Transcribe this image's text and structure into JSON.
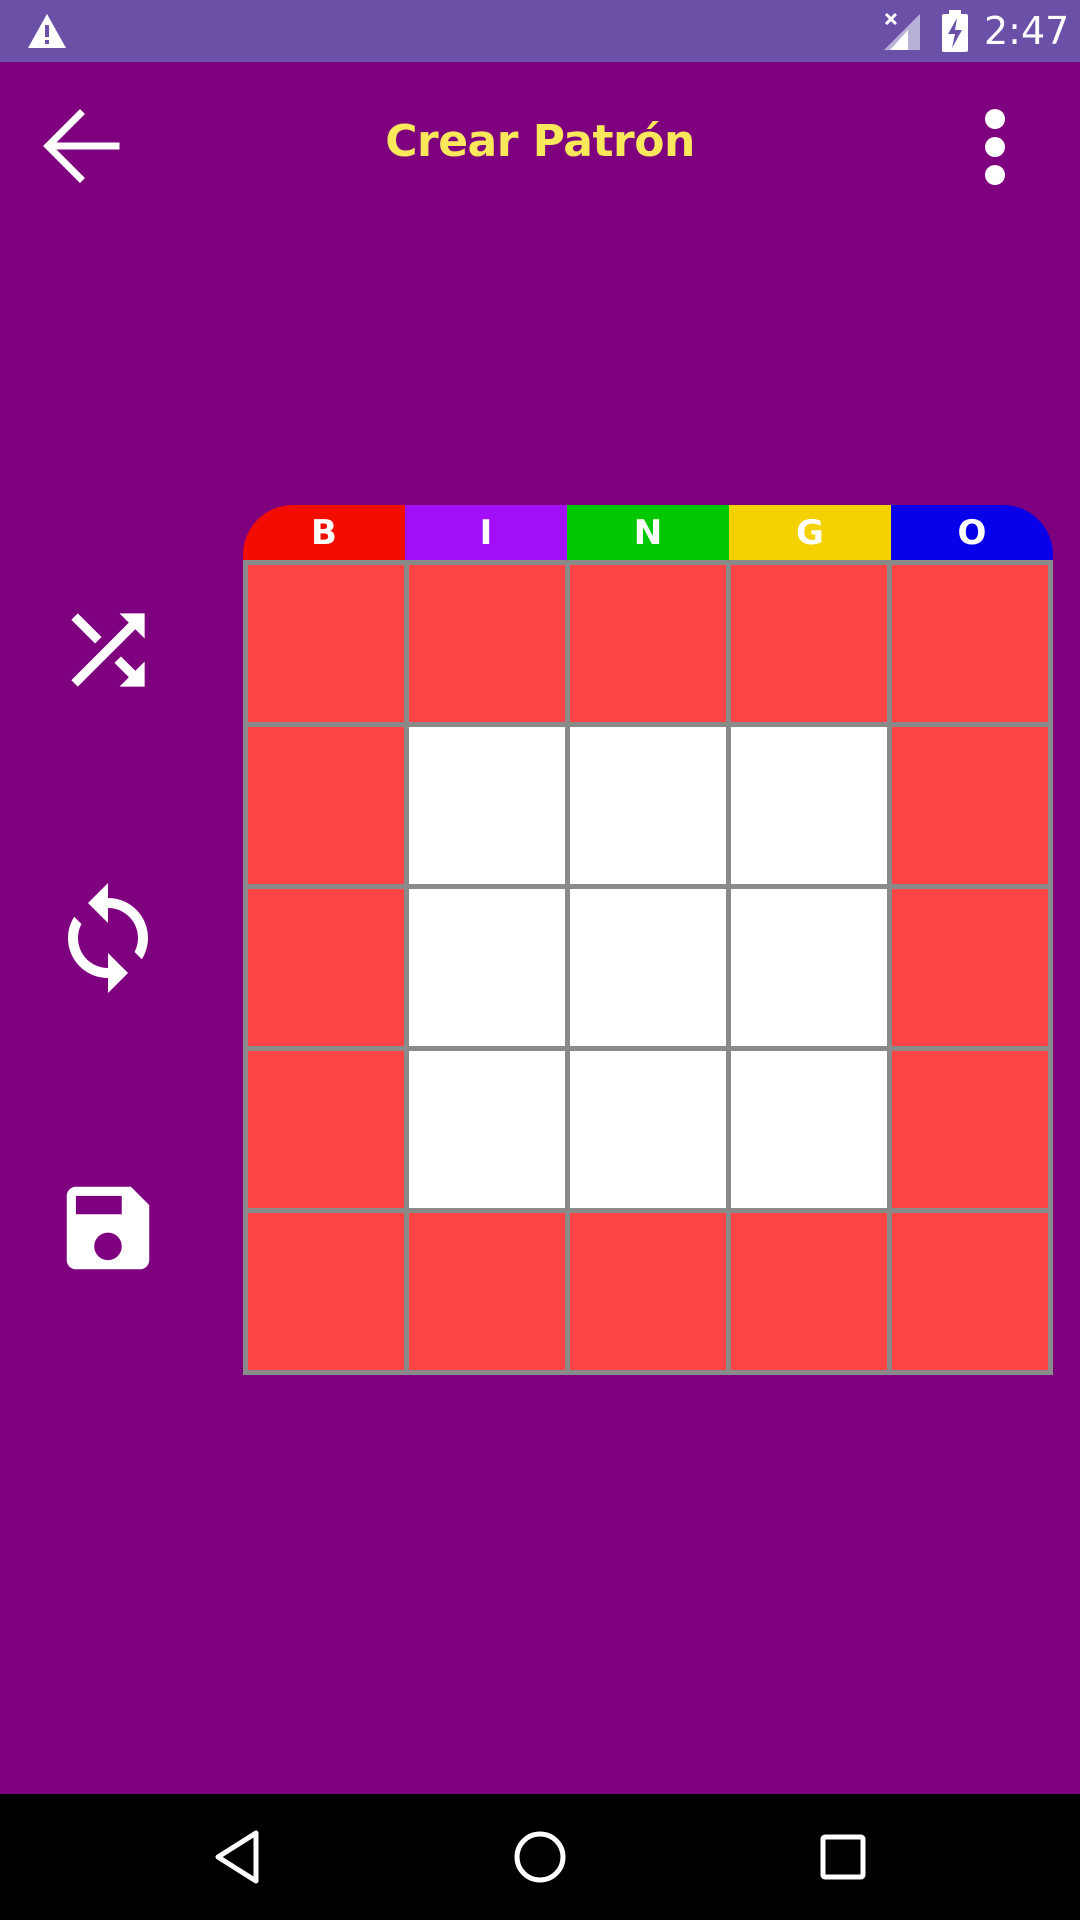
{
  "status_bar": {
    "time": "2:47",
    "icons": [
      "warning-icon",
      "signal-off-icon",
      "battery-charging-icon"
    ]
  },
  "toolbar": {
    "title": "Crear Patrón",
    "back_icon": "arrow-back-icon",
    "more_icon": "more-vert-icon"
  },
  "actions": {
    "shuffle_icon": "shuffle-icon",
    "refresh_icon": "refresh-icon",
    "save_icon": "save-icon"
  },
  "board": {
    "header": [
      {
        "letter": "B",
        "color": "#f20d00"
      },
      {
        "letter": "I",
        "color": "#a10ef7"
      },
      {
        "letter": "N",
        "color": "#00c800"
      },
      {
        "letter": "G",
        "color": "#f4d100"
      },
      {
        "letter": "O",
        "color": "#0800e8"
      }
    ],
    "pattern": [
      [
        1,
        1,
        1,
        1,
        1
      ],
      [
        1,
        0,
        0,
        0,
        1
      ],
      [
        1,
        0,
        0,
        0,
        1
      ],
      [
        1,
        0,
        0,
        0,
        1
      ],
      [
        1,
        1,
        1,
        1,
        1
      ]
    ],
    "colors": {
      "selected": "#fe4444",
      "unselected": "#ffffff",
      "grid_lines": "#8a8a8a"
    }
  },
  "nav_bar": {
    "icons": [
      "nav-back-icon",
      "nav-home-icon",
      "nav-recents-icon"
    ]
  },
  "colors": {
    "background": "#7e007f",
    "status_bar": "#6a50a7",
    "title": "#f8e85a"
  }
}
